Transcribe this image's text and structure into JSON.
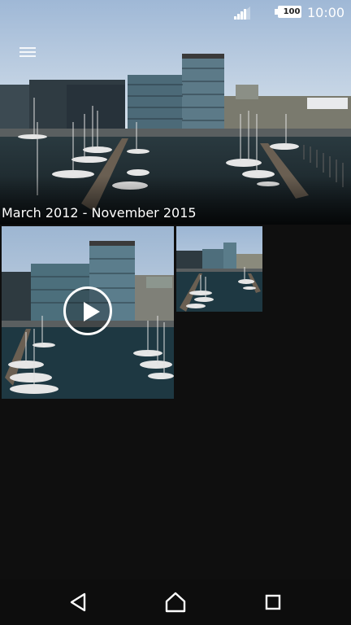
{
  "status_bar": {
    "time": "10:00",
    "battery_level": "100",
    "signal_icon": "cellular-signal-icon",
    "battery_icon": "battery-icon"
  },
  "header": {
    "menu_icon": "hamburger-menu-icon",
    "date_range": "March 2012 - November 2015"
  },
  "grid": {
    "items": [
      {
        "type": "video",
        "badge_icon": "play-icon"
      },
      {
        "type": "photo"
      }
    ]
  },
  "nav_bar": {
    "back_icon": "back-triangle-icon",
    "home_icon": "home-icon",
    "recent_icon": "recent-apps-icon"
  },
  "colors": {
    "background": "#0f0f0f",
    "sky": "#b9cde0",
    "water": "#1c3640",
    "text": "#ffffff"
  }
}
